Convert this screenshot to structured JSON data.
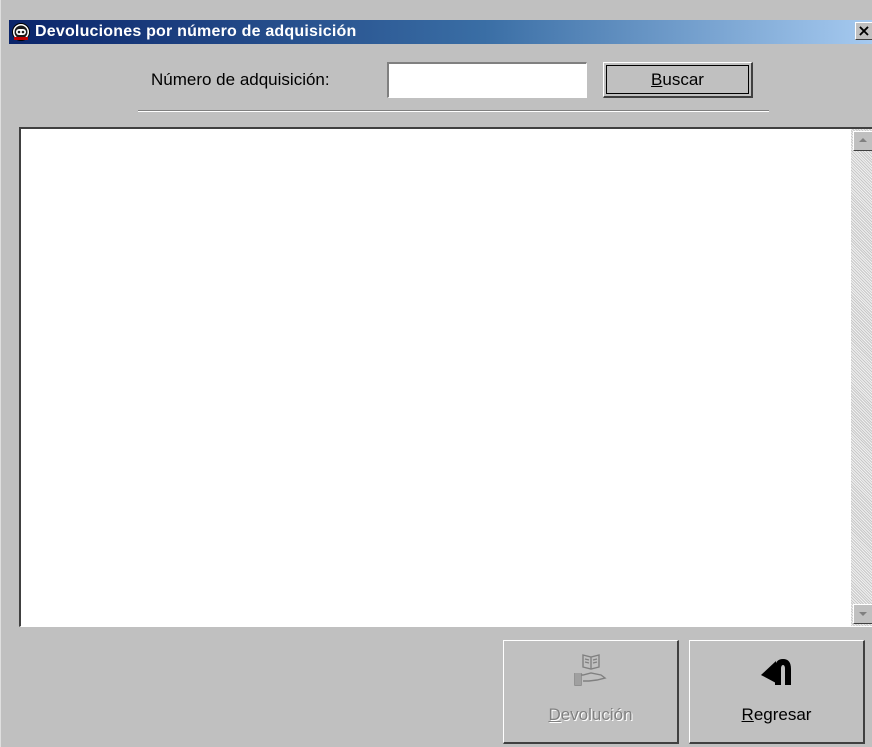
{
  "window": {
    "title": "Devoluciones por número de adquisición",
    "close_label": "×"
  },
  "search": {
    "label": "Número de adquisición:",
    "value": "",
    "placeholder": "",
    "button_label_mnemonic": "B",
    "button_label_rest": "uscar"
  },
  "results": {
    "items": []
  },
  "actions": {
    "devolucion": {
      "label_mnemonic": "D",
      "label_rest": "evolución",
      "enabled": false,
      "icon": "book-hand-icon"
    },
    "regresar": {
      "label_mnemonic": "R",
      "label_rest": "egresar",
      "enabled": true,
      "icon": "u-turn-arrow-icon"
    }
  },
  "colors": {
    "titlebar_start": "#0a246a",
    "titlebar_end": "#a6caf0",
    "window_bg": "#c0c0c0",
    "disabled_text": "#808080"
  }
}
